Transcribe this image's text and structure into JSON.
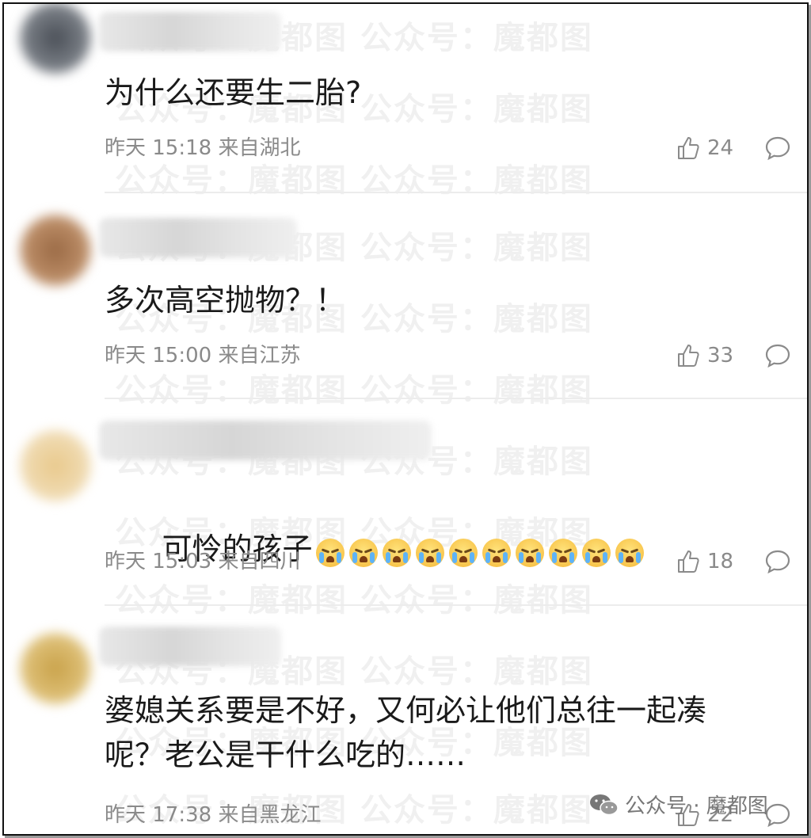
{
  "comments": [
    {
      "text": "为什么还要生二胎?",
      "time": "昨天 15:18 来自湖北",
      "likes": "24"
    },
    {
      "text": "多次高空抛物？！",
      "time": "昨天 15:00 来自江苏",
      "likes": "33"
    },
    {
      "text": "可怜的孩子",
      "emoji_count": 10,
      "emoji_icon": "loudly-crying-face-icon",
      "time": "昨天 15:03 来自四川",
      "likes": "18"
    },
    {
      "text": "婆媳关系要是不好，又何必让他们总往一起凑\n呢？老公是干什么吃的……",
      "time": "昨天 17:38 来自黑龙江",
      "likes": "22"
    }
  ],
  "watermark": {
    "text": "公众号：魔都图",
    "badge_text": "公众号 · 魔都图"
  },
  "colors": {
    "meta": "#8a8a8a",
    "text": "#1a1a1a",
    "divider": "#ececec"
  }
}
